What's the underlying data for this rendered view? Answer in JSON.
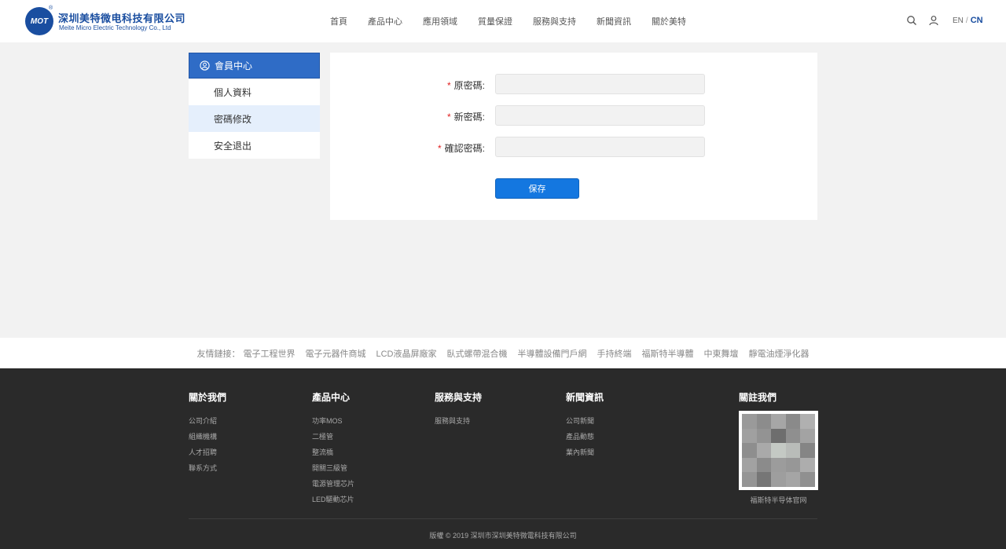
{
  "header": {
    "logo_mark": "MOT",
    "logo_reg": "®",
    "logo_cn": "深圳美特微电科技有限公司",
    "logo_en": "Meite Micro Electric Technology Co., Ltd",
    "nav": [
      "首頁",
      "產品中心",
      "應用領域",
      "質量保證",
      "服務與支持",
      "新聞資訊",
      "關於美特"
    ],
    "lang_en": "EN",
    "lang_sep": "/",
    "lang_cn": "CN",
    "icons": [
      "search-icon",
      "user-icon"
    ]
  },
  "sidebar": {
    "title": "會員中心",
    "items": [
      {
        "label": "個人資料",
        "active": false
      },
      {
        "label": "密碼修改",
        "active": true
      },
      {
        "label": "安全退出",
        "active": false
      }
    ]
  },
  "form": {
    "required_mark": "*",
    "fields": [
      {
        "label": "原密碼:",
        "value": "",
        "placeholder": ""
      },
      {
        "label": "新密碼:",
        "value": "",
        "placeholder": ""
      },
      {
        "label": "確認密碼:",
        "value": "",
        "placeholder": ""
      }
    ],
    "save_label": "保存"
  },
  "links": {
    "prefix": "友情鏈接：",
    "items": [
      "電子工程世界",
      "電子元器件商城",
      "LCD液晶屏廠家",
      "臥式螺帶混合機",
      "半導體設備門戶網",
      "手持終端",
      "福斯特半導體",
      "中東舞壇",
      "靜電油煙淨化器"
    ]
  },
  "footer": {
    "columns": [
      {
        "title": "關於我們",
        "links": [
          "公司介紹",
          "組織機構",
          "人才招聘",
          "聯系方式"
        ]
      },
      {
        "title": "產品中心",
        "links": [
          "功率MOS",
          "二極管",
          "整流橋",
          "開關三級管",
          "電源管理芯片",
          "LED驅動芯片"
        ]
      },
      {
        "title": "服務與支持",
        "links": [
          "服務與支持"
        ]
      },
      {
        "title": "新聞資訊",
        "links": [
          "公司新聞",
          "產品動態",
          "業內新聞"
        ]
      }
    ],
    "follow_title": "關註我們",
    "qr_caption": "福斯特半导体官网",
    "copyright": "版權 © 2019 深圳市深圳美特微電科技有限公司"
  },
  "colors": {
    "brand": "#1a4ea0",
    "sidebar_head": "#2f6cc6",
    "button": "#1477e0",
    "required": "#e02020",
    "footer_bg": "#2a2a2a"
  }
}
